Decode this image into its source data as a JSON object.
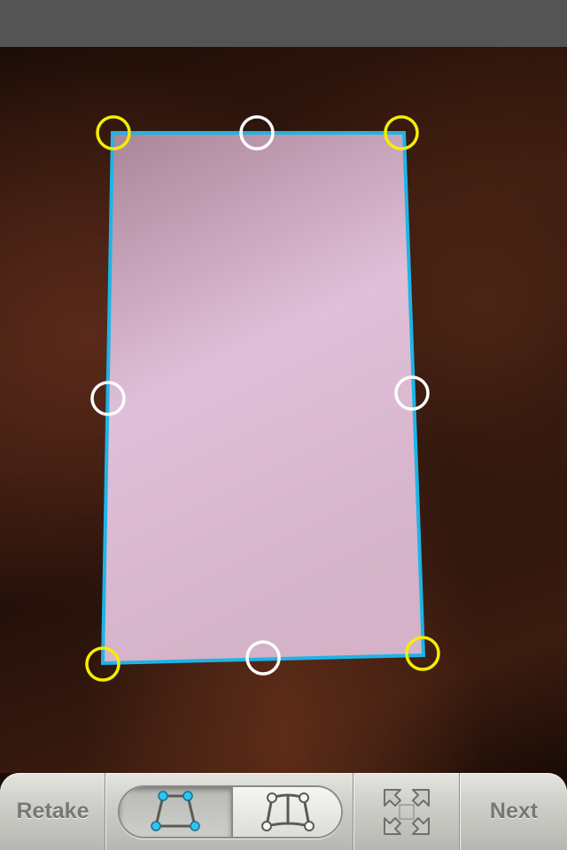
{
  "toolbar": {
    "retake_label": "Retake",
    "next_label": "Next",
    "mode_buttons": [
      {
        "icon": "quad-crop-icon",
        "selected": true
      },
      {
        "icon": "curved-page-icon",
        "selected": false
      }
    ],
    "expand_icon": "expand-arrows-icon"
  },
  "colors": {
    "crop_outline": "#1eb4e6",
    "corner_handle": "#f5ee00",
    "edge_handle": "#ffffff",
    "document_fill": "#d9b8d0",
    "status_bar": "#545454"
  }
}
